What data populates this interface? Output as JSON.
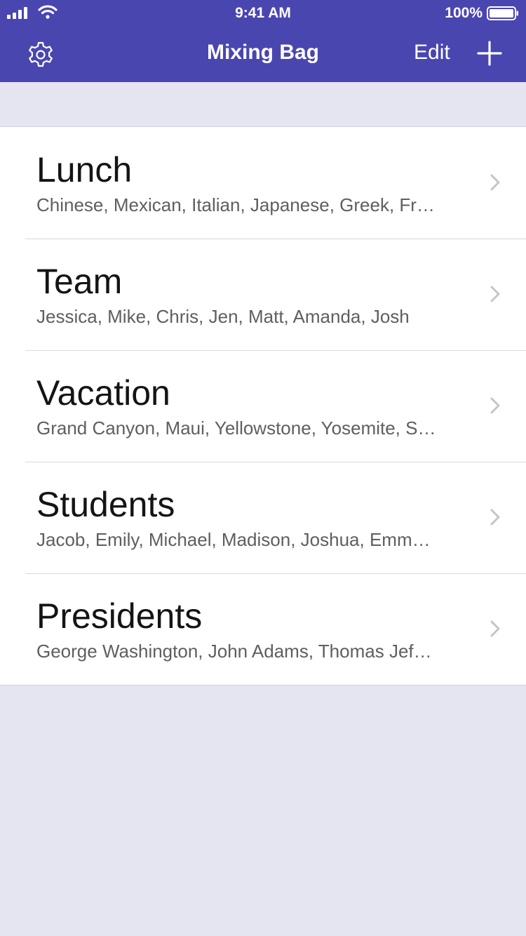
{
  "status_bar": {
    "time": "9:41 AM",
    "battery": "100%"
  },
  "nav": {
    "title": "Mixing Bag",
    "edit_label": "Edit",
    "settings_icon": "gear-icon",
    "add_icon": "plus-icon"
  },
  "colors": {
    "nav_background": "#4a46b0",
    "page_background": "#e5e5f1"
  },
  "lists": [
    {
      "title": "Lunch",
      "items": "Chinese, Mexican, Italian, Japanese, Greek, Fr…"
    },
    {
      "title": "Team",
      "items": "Jessica, Mike, Chris, Jen, Matt, Amanda, Josh"
    },
    {
      "title": "Vacation",
      "items": "Grand Canyon, Maui, Yellowstone, Yosemite, S…"
    },
    {
      "title": "Students",
      "items": "Jacob, Emily, Michael, Madison, Joshua, Emm…"
    },
    {
      "title": "Presidents",
      "items": "George Washington, John Adams, Thomas Jef…"
    }
  ]
}
